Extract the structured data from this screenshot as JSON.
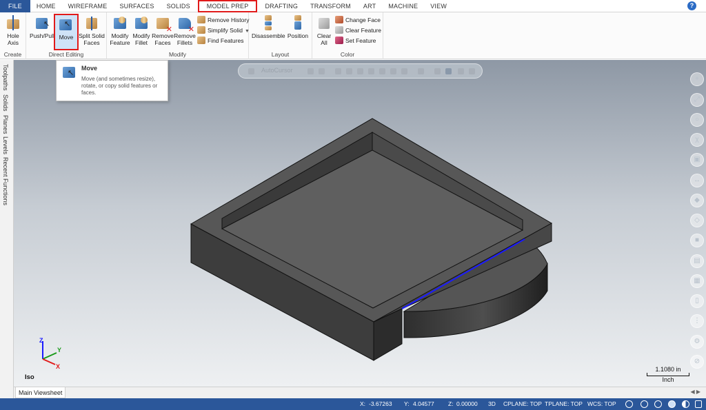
{
  "tabs": [
    "FILE",
    "HOME",
    "WIREFRAME",
    "SURFACES",
    "SOLIDS",
    "MODEL PREP",
    "DRAFTING",
    "TRANSFORM",
    "ART",
    "MACHINE",
    "VIEW"
  ],
  "active_tab": "MODEL PREP",
  "help_icon": "?",
  "groups": {
    "create": {
      "label": "Create",
      "hole_axis": "Hole\nAxis"
    },
    "direct_editing": {
      "label": "Direct Editing",
      "push_pull": "Push/Pull",
      "move": "Move",
      "split_solid_faces": "Split Solid\nFaces"
    },
    "modify": {
      "label": "Modify",
      "modify_feature": "Modify\nFeature",
      "modify_fillet": "Modify\nFillet",
      "remove_faces": "Remove\nFaces",
      "remove_fillets": "Remove\nFillets",
      "remove_history": "Remove History",
      "simplify_solid": "Simplify Solid",
      "find_features": "Find Features"
    },
    "layout": {
      "label": "Layout",
      "disassemble": "Disassemble",
      "position": "Position"
    },
    "color": {
      "label": "Color",
      "clear_all": "Clear\nAll",
      "change_face": "Change Face",
      "clear_feature": "Clear Feature",
      "set_feature": "Set Feature"
    }
  },
  "tooltip": {
    "title": "Move",
    "body": "Move (and sometimes resize), rotate, or copy solid features or faces."
  },
  "left_panel": [
    "Toolpaths",
    "Solids",
    "Planes",
    "Levels",
    "Recent Functions"
  ],
  "viewport": {
    "floatbar_text": "AutoCursor",
    "view_label": "Iso",
    "scale_value": "1.1080 in",
    "scale_unit": "Inch",
    "axes": {
      "z": "Z",
      "y": "Y",
      "x": "X"
    }
  },
  "sheet_tab": "Main Viewsheet",
  "status": {
    "x_label": "X:",
    "x_value": "-3.67263",
    "y_label": "Y:",
    "y_value": "4.04577",
    "z_label": "Z:",
    "z_value": "0.00000",
    "mode": "3D",
    "cplane": "CPLANE: TOP",
    "tplane": "TPLANE: TOP",
    "wcs": "WCS: TOP"
  },
  "colors": {
    "accent": "#2b579a",
    "highlight": "#e11a1a",
    "edge": "#1a1aff"
  }
}
